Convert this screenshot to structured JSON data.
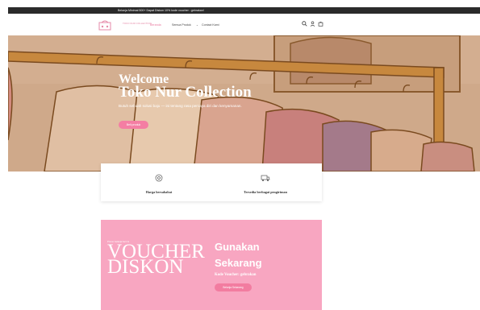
{
  "announcement": "Belanja Minimal 500+ Dapat Diskon 10% kode voucher : gebrakan!",
  "header": {
    "logo_text": "TOKO NUR COLLECTION",
    "nav": [
      "Beranda",
      "Semua Produk",
      "Contact Kami"
    ]
  },
  "hero": {
    "welcome": "Welcome",
    "brand": "Toko Nur Collection",
    "tagline": "Butuh sebuah solusi baju — ini tentang rasa percaya diri dan kenyamanan.",
    "button": "Beli produk"
  },
  "features": [
    {
      "label": "Harga bersahabat",
      "icon": "price-tag-icon"
    },
    {
      "label": "Tersedia berbagai pengiriman",
      "icon": "shipping-icon"
    }
  ],
  "voucher": {
    "small": "Promo belanja hari ini",
    "big_line1": "VOUCHER",
    "big_line2": "DISKON",
    "title_line1": "Gunakan",
    "title_line2": "Sekarang",
    "code": "Kode Voucher: gebrakan",
    "button": "Belanja Sekarang"
  },
  "colors": {
    "accent_pink": "#f47ea3",
    "voucher_bg": "#f8a6c1",
    "hero_bg": "#caa485",
    "announcement_bg": "#2b2b2b"
  }
}
